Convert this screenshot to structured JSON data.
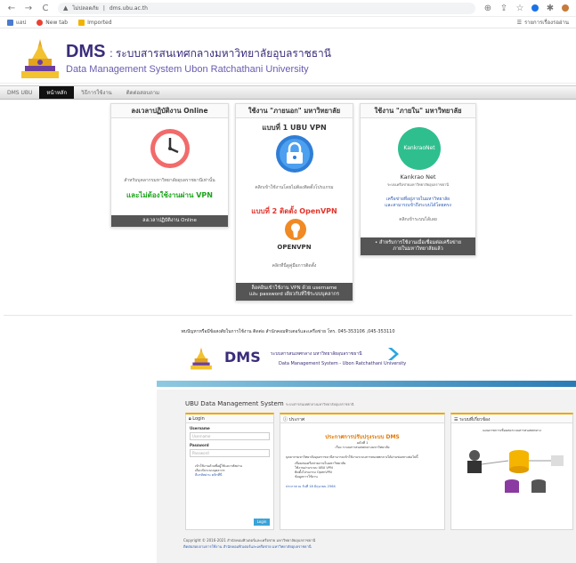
{
  "browser": {
    "url_prefix": "ไม่ปลอดภัย",
    "url": "dms.ubu.ac.th",
    "bookmarks": [
      {
        "label": "แอป"
      },
      {
        "label": "New tab"
      },
      {
        "label": "Imported"
      }
    ],
    "reading_list": "รายการเรื่องรออ่าน"
  },
  "header": {
    "dms": "DMS",
    "title_th": ": ระบบสารสนเทศกลางมหาวิทยาลัยอุบลราชธานี",
    "title_en": "Data Management System Ubon Ratchathani University"
  },
  "menu": [
    {
      "label": "DMS UBU",
      "active": false
    },
    {
      "label": "หน้าหลัก",
      "active": true
    },
    {
      "label": "วิธีการใช้งาน",
      "active": false
    },
    {
      "label": "ติดต่อสอบถาม",
      "active": false
    }
  ],
  "cards": {
    "online": {
      "title": "ลงเวลาปฏิบัติงาน Online",
      "desc": "สำหรับบุคลากรมหาวิทยาลัยอุบลราชธานีเท่านั้น",
      "green_text": "และไม่ต้องใช้งานผ่าน VPN",
      "footer": "ลงเวลาปฏิบัติงาน Online"
    },
    "outside": {
      "title": "ใช้งาน \"ภายนอก\" มหาวิทยาลัย",
      "method1": "แบบที่ 1 UBU VPN",
      "method1_desc": "คลิกเข้าใช้งานโดยไม่ต้องติดตั้งโปรแกรม",
      "method2": "แบบที่ 2 ติดตั้ง OpenVPN",
      "openvpn_logo": "OPENVPN",
      "method2_desc": "คลิกที่นี่ดูคู่มือการติดตั้ง",
      "footer_line1": "ล็อคอินเข้าใช้งาน VPN ด้วย username",
      "footer_line2": "และ password เดียวกับที่ใช้ระบบบุคลากร"
    },
    "inside": {
      "title": "ใช้งาน \"ภายใน\" มหาวิทยาลัย",
      "logo_text": "KankraoNet",
      "name": "Kankrao Net",
      "name_sub": "ระบบเครือข่ายมหาวิทยาลัยอุบลราชธานี",
      "link1": "เครือข่ายที่อยู่ภายในมหาวิทยาลัย",
      "link2": "และสามารถเข้าถึงระบบได้โดยตรง",
      "link3": "คลิกเข้าระบบได้เลย",
      "footer_line1": "• สำหรับการใช้งานเมื่อเชื่อมต่อเครือข่าย",
      "footer_line2": "ภายในมหาวิทยาลัยแล้ว"
    }
  },
  "contact": "พบปัญหาหรือมีข้อสงสัยในการใช้งาน ติดต่อ สำนักคอมพิวเตอร์และเครือข่าย โทร. 045-353106 ,045-353110",
  "embedded": {
    "dms": "DMS",
    "title_th": "ระบบสารสนเทศกลาง มหาวิทยาลัยอุบลราชธานี",
    "title_en": "Data Management System - Ubon Ratchathani University",
    "system_title": "UBU Data Management System",
    "system_sub": "ระบบสารสนเทศกลางมหาวิทยาลัยอุบลราชธานี",
    "login": {
      "head": "Login",
      "username_label": "Username",
      "username_placeholder": "Username",
      "password_label": "Password",
      "password_placeholder": "Password",
      "note1": "เข้าใช้งานด้วยชื่อผู้ใช้และรหัสผ่าน",
      "note2": "เดียวกับระบบบุคลากร",
      "note3": "ลืมรหัสผ่าน คลิกที่นี่",
      "button": "Login"
    },
    "news": {
      "head": "ประกาศ",
      "title1": "ประกาศการปรับปรุงระบบ DMS",
      "title2": "ฉบับที่ 1",
      "sub": "เรื่อง ระบบสารสนเทศกลางมหาวิทยาลัย",
      "body": "บุคลากรมหาวิทยาลัยอุบลราชธานีสามารถเข้าใช้งานระบบสารสนเทศกลางได้ผ่านช่องทางต่อไปนี้",
      "bullets": [
        "เชื่อมต่อเครือข่ายภายในมหาวิทยาลัย",
        "ใช้งานผ่านระบบ UBU VPN",
        "ติดตั้งโปรแกรม OpenVPN",
        "ข้อมูลการใช้งาน"
      ],
      "footer": "ประกาศ ณ วันที่ 18 มิถุนายน 2564"
    },
    "related": {
      "head": "ระบบที่เกี่ยวข้อง",
      "diagram_title": "แผนภาพการเชื่อมต่อระบบสารสนเทศกลาง"
    },
    "footer_line1": "Copyright © 2016-2021 สำนักคอมพิวเตอร์และเครือข่าย มหาวิทยาลัยอุบลราชธานี",
    "footer_line2": "ติดต่อสอบถามการใช้งาน สำนักคอมพิวเตอร์และเครือข่าย มหาวิทยาลัยอุบลราชธานี"
  },
  "colors": {
    "brand": "#3a2c7a",
    "green": "#1ea51e",
    "red": "#e2342c",
    "orange": "#e07800",
    "vpn_blue": "#2f7ed6",
    "kankrao_green": "#2fbf8f"
  }
}
